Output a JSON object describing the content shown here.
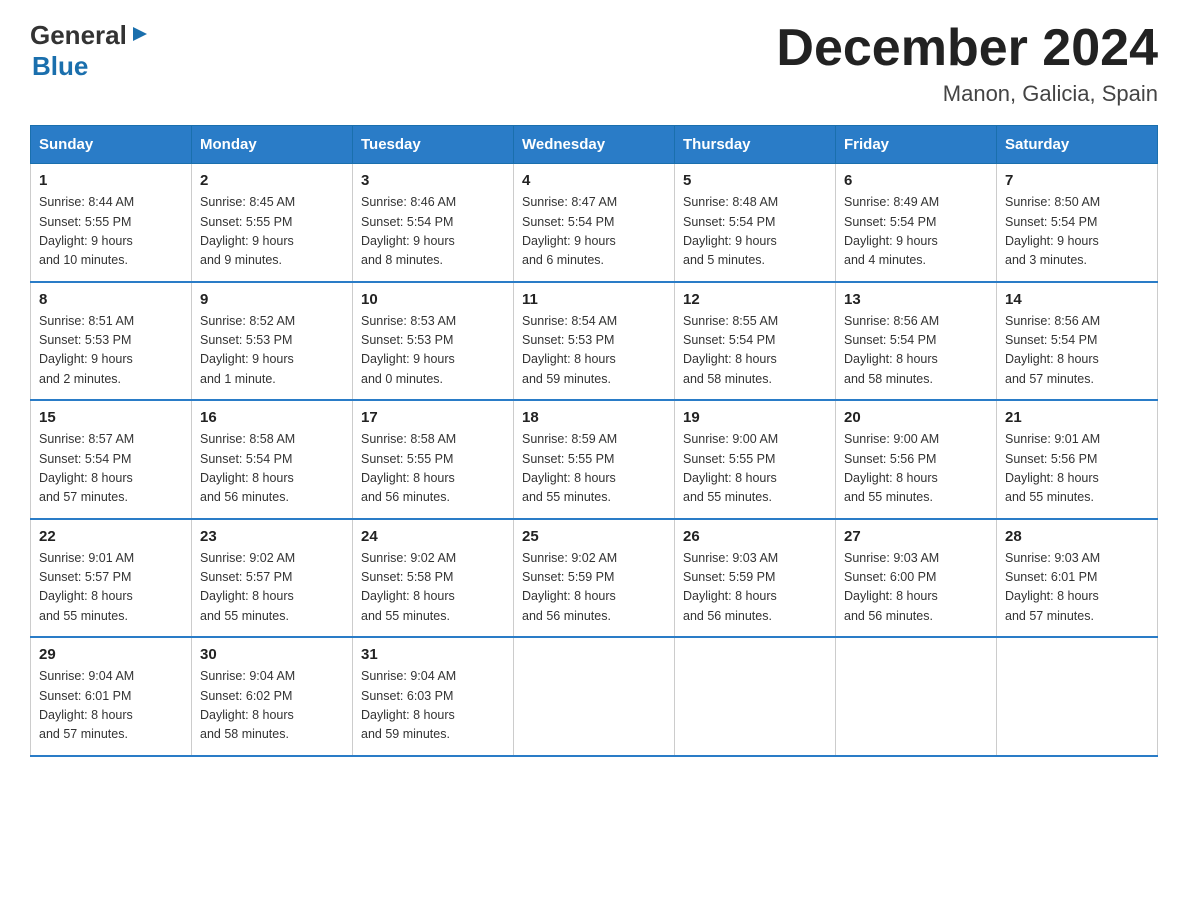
{
  "logo": {
    "general": "General",
    "blue": "Blue",
    "arrow": "▶"
  },
  "title": {
    "month": "December 2024",
    "location": "Manon, Galicia, Spain"
  },
  "days_of_week": [
    "Sunday",
    "Monday",
    "Tuesday",
    "Wednesday",
    "Thursday",
    "Friday",
    "Saturday"
  ],
  "weeks": [
    [
      {
        "day": "1",
        "sunrise": "8:44 AM",
        "sunset": "5:55 PM",
        "daylight": "9 hours and 10 minutes."
      },
      {
        "day": "2",
        "sunrise": "8:45 AM",
        "sunset": "5:55 PM",
        "daylight": "9 hours and 9 minutes."
      },
      {
        "day": "3",
        "sunrise": "8:46 AM",
        "sunset": "5:54 PM",
        "daylight": "9 hours and 8 minutes."
      },
      {
        "day": "4",
        "sunrise": "8:47 AM",
        "sunset": "5:54 PM",
        "daylight": "9 hours and 6 minutes."
      },
      {
        "day": "5",
        "sunrise": "8:48 AM",
        "sunset": "5:54 PM",
        "daylight": "9 hours and 5 minutes."
      },
      {
        "day": "6",
        "sunrise": "8:49 AM",
        "sunset": "5:54 PM",
        "daylight": "9 hours and 4 minutes."
      },
      {
        "day": "7",
        "sunrise": "8:50 AM",
        "sunset": "5:54 PM",
        "daylight": "9 hours and 3 minutes."
      }
    ],
    [
      {
        "day": "8",
        "sunrise": "8:51 AM",
        "sunset": "5:53 PM",
        "daylight": "9 hours and 2 minutes."
      },
      {
        "day": "9",
        "sunrise": "8:52 AM",
        "sunset": "5:53 PM",
        "daylight": "9 hours and 1 minute."
      },
      {
        "day": "10",
        "sunrise": "8:53 AM",
        "sunset": "5:53 PM",
        "daylight": "9 hours and 0 minutes."
      },
      {
        "day": "11",
        "sunrise": "8:54 AM",
        "sunset": "5:53 PM",
        "daylight": "8 hours and 59 minutes."
      },
      {
        "day": "12",
        "sunrise": "8:55 AM",
        "sunset": "5:54 PM",
        "daylight": "8 hours and 58 minutes."
      },
      {
        "day": "13",
        "sunrise": "8:56 AM",
        "sunset": "5:54 PM",
        "daylight": "8 hours and 58 minutes."
      },
      {
        "day": "14",
        "sunrise": "8:56 AM",
        "sunset": "5:54 PM",
        "daylight": "8 hours and 57 minutes."
      }
    ],
    [
      {
        "day": "15",
        "sunrise": "8:57 AM",
        "sunset": "5:54 PM",
        "daylight": "8 hours and 57 minutes."
      },
      {
        "day": "16",
        "sunrise": "8:58 AM",
        "sunset": "5:54 PM",
        "daylight": "8 hours and 56 minutes."
      },
      {
        "day": "17",
        "sunrise": "8:58 AM",
        "sunset": "5:55 PM",
        "daylight": "8 hours and 56 minutes."
      },
      {
        "day": "18",
        "sunrise": "8:59 AM",
        "sunset": "5:55 PM",
        "daylight": "8 hours and 55 minutes."
      },
      {
        "day": "19",
        "sunrise": "9:00 AM",
        "sunset": "5:55 PM",
        "daylight": "8 hours and 55 minutes."
      },
      {
        "day": "20",
        "sunrise": "9:00 AM",
        "sunset": "5:56 PM",
        "daylight": "8 hours and 55 minutes."
      },
      {
        "day": "21",
        "sunrise": "9:01 AM",
        "sunset": "5:56 PM",
        "daylight": "8 hours and 55 minutes."
      }
    ],
    [
      {
        "day": "22",
        "sunrise": "9:01 AM",
        "sunset": "5:57 PM",
        "daylight": "8 hours and 55 minutes."
      },
      {
        "day": "23",
        "sunrise": "9:02 AM",
        "sunset": "5:57 PM",
        "daylight": "8 hours and 55 minutes."
      },
      {
        "day": "24",
        "sunrise": "9:02 AM",
        "sunset": "5:58 PM",
        "daylight": "8 hours and 55 minutes."
      },
      {
        "day": "25",
        "sunrise": "9:02 AM",
        "sunset": "5:59 PM",
        "daylight": "8 hours and 56 minutes."
      },
      {
        "day": "26",
        "sunrise": "9:03 AM",
        "sunset": "5:59 PM",
        "daylight": "8 hours and 56 minutes."
      },
      {
        "day": "27",
        "sunrise": "9:03 AM",
        "sunset": "6:00 PM",
        "daylight": "8 hours and 56 minutes."
      },
      {
        "day": "28",
        "sunrise": "9:03 AM",
        "sunset": "6:01 PM",
        "daylight": "8 hours and 57 minutes."
      }
    ],
    [
      {
        "day": "29",
        "sunrise": "9:04 AM",
        "sunset": "6:01 PM",
        "daylight": "8 hours and 57 minutes."
      },
      {
        "day": "30",
        "sunrise": "9:04 AM",
        "sunset": "6:02 PM",
        "daylight": "8 hours and 58 minutes."
      },
      {
        "day": "31",
        "sunrise": "9:04 AM",
        "sunset": "6:03 PM",
        "daylight": "8 hours and 59 minutes."
      },
      null,
      null,
      null,
      null
    ]
  ],
  "labels": {
    "sunrise": "Sunrise:",
    "sunset": "Sunset:",
    "daylight": "Daylight:"
  }
}
